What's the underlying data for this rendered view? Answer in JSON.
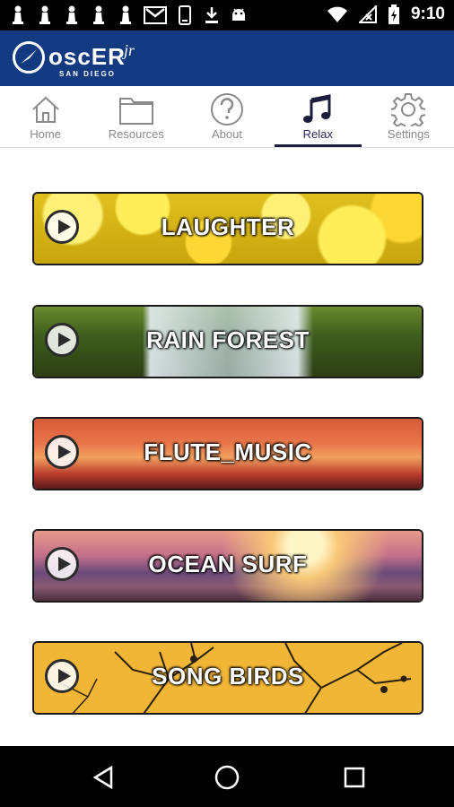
{
  "status_bar": {
    "time": "9:10",
    "left_icons": [
      "chess-pawn-icon",
      "chess-pawn-icon",
      "chess-pawn-icon",
      "chess-pawn-icon",
      "chess-pawn-icon",
      "gmail-icon",
      "phone-icon",
      "download-icon",
      "android-icon"
    ],
    "right_icons": [
      "wifi-icon",
      "signal-off-icon",
      "battery-charging-icon"
    ]
  },
  "app_bar": {
    "logo_text": "oscER",
    "logo_jr": "jr",
    "logo_sub": "SAN DIEGO",
    "color": "#133a80"
  },
  "tabs": [
    {
      "label": "Home",
      "icon": "home-icon",
      "active": false
    },
    {
      "label": "Resources",
      "icon": "folder-icon",
      "active": false
    },
    {
      "label": "About",
      "icon": "question-icon",
      "active": false
    },
    {
      "label": "Relax",
      "icon": "music-note-icon",
      "active": true
    },
    {
      "label": "Settings",
      "icon": "gear-icon",
      "active": false
    }
  ],
  "sounds": [
    {
      "label": "LAUGHTER"
    },
    {
      "label": "RAIN FOREST"
    },
    {
      "label": "FLUTE_MUSIC"
    },
    {
      "label": "OCEAN SURF"
    },
    {
      "label": "SONG BIRDS"
    }
  ],
  "nav_bar": {
    "buttons": [
      "back-icon",
      "home-circle-icon",
      "recents-square-icon"
    ]
  }
}
